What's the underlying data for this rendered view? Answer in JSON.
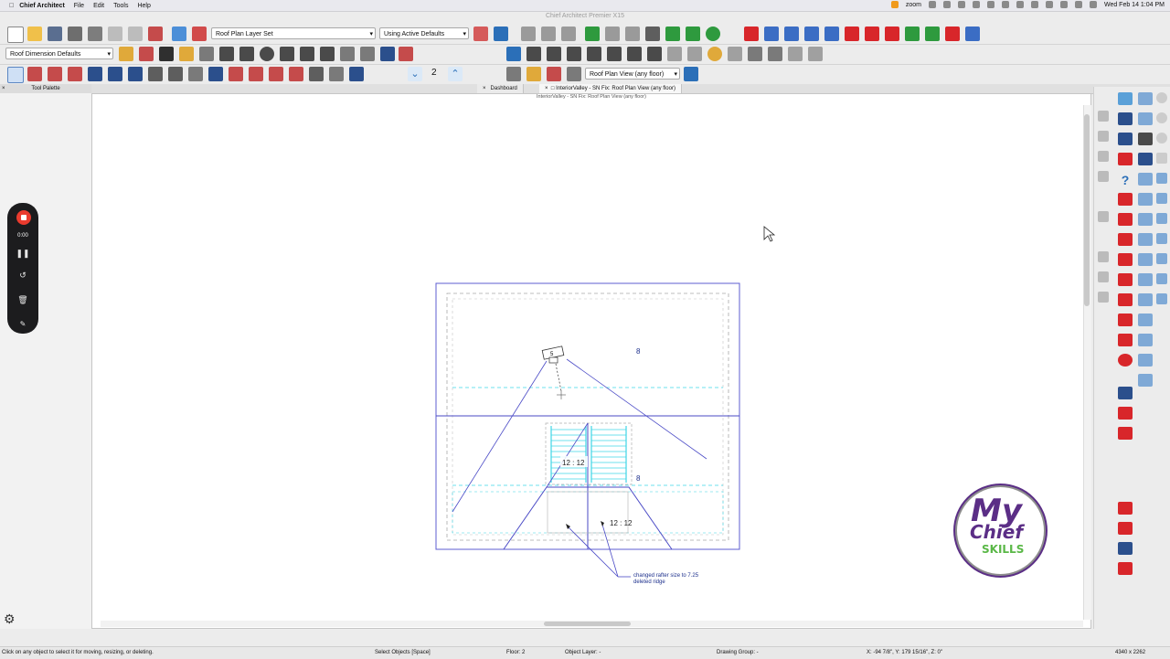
{
  "menubar": {
    "app_name": "Chief Architect",
    "items": [
      "File",
      "Edit",
      "Tools",
      "Help"
    ],
    "zoom_label": "zoom",
    "clock": "Wed Feb 14  1:04 PM"
  },
  "window": {
    "title": "Chief Architect Premier X15"
  },
  "toolbar1": {
    "layer_set": "Roof Plan Layer Set",
    "defaults": "Using Active Defaults"
  },
  "toolbar2": {
    "dimension_defaults": "Roof Dimension Defaults"
  },
  "toolbar3": {
    "step_value": "2",
    "view_select": "Roof Plan View (any floor)"
  },
  "tabs": {
    "palette": "Tool Palette",
    "items": [
      {
        "label": "Dashboard"
      },
      {
        "label": "InteriorValley - SN Fix:  Roof Plan View (any floor)"
      }
    ]
  },
  "document": {
    "title": "InteriorValley - SN Fix:  Roof Plan View (any floor)"
  },
  "drawing": {
    "camera_label": "5",
    "pitch_labels": [
      "12 : 12",
      "12 : 12"
    ],
    "roof_labels": [
      "8",
      "8"
    ],
    "note_line1": "changed rafter size to 7.25",
    "note_line2": "deleted ridge"
  },
  "recorder": {
    "time": "0:00"
  },
  "logo": {
    "line1": "My",
    "line2": "Chief",
    "line3": "SKILLS"
  },
  "statusbar": {
    "hint": "Click on any object to select it for moving, resizing, or deleting.",
    "mode": "Select Objects [Space]",
    "floor": "Floor: 2",
    "object_layer": "Object Layer: -",
    "drawing_group": "Drawing Group: -",
    "coords": "X: -94 7/8\", Y: 179 15/16\", Z: 0\"",
    "resolution": "4340 x 2262"
  },
  "colors": {
    "plan_blue": "#4a4ac6",
    "cyan": "#3fd6e6",
    "accent_red": "#d8262a",
    "logo_purple": "#5b2e86"
  }
}
